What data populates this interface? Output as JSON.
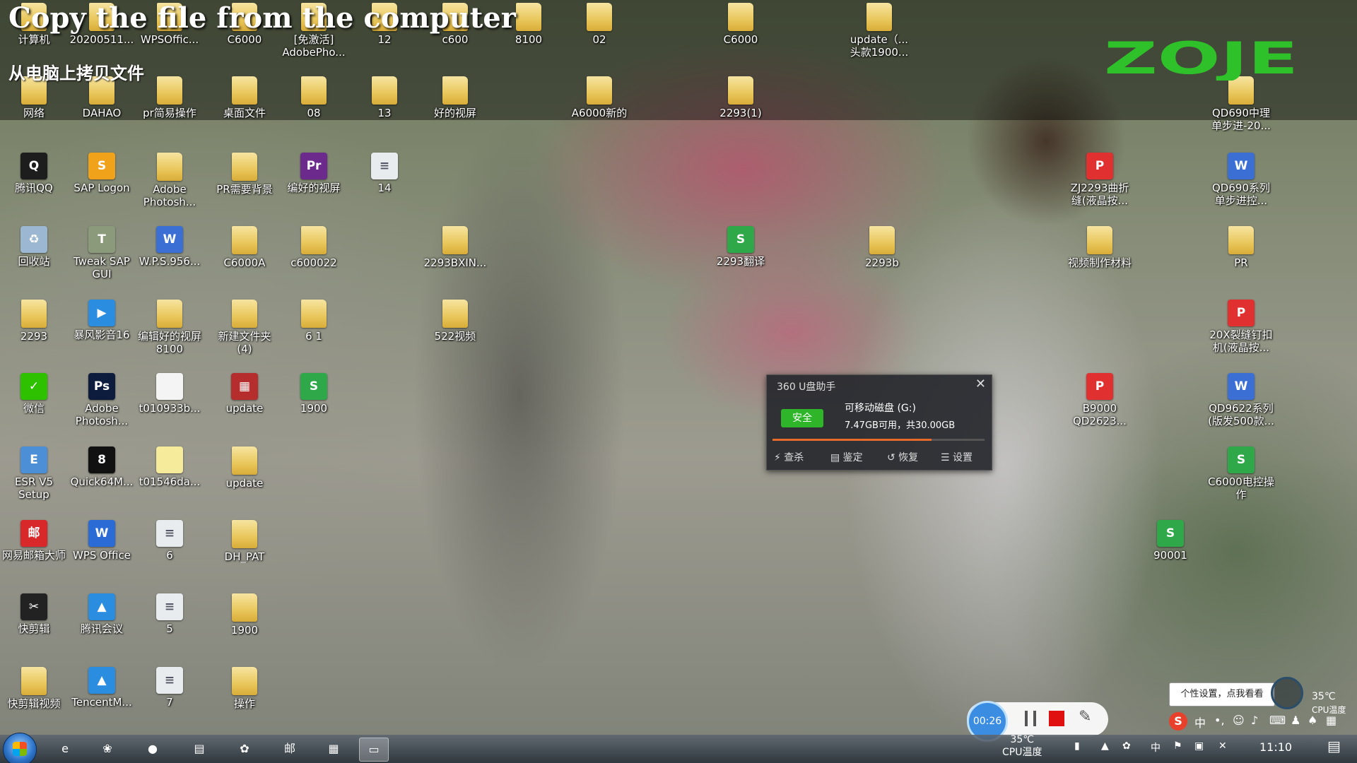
{
  "titles": {
    "english": "Copy the file from the computer",
    "chinese": "从电脑上拷贝文件"
  },
  "logo": "ZOJE",
  "top_icons": [
    {
      "label": "计算机"
    },
    {
      "label": "20200511..."
    },
    {
      "label": "WPSOffic..."
    },
    {
      "label": "C6000"
    },
    {
      "label": "[免激活] AdobePho..."
    },
    {
      "label": "12"
    },
    {
      "label": "c600"
    },
    {
      "label": "8100"
    },
    {
      "label": "02"
    },
    {
      "label": "C6000"
    },
    {
      "label": "update（... 头款1900..."
    },
    {
      "label": "网络"
    },
    {
      "label": "DAHAO"
    },
    {
      "label": "pr简易操作"
    },
    {
      "label": "桌面文件"
    },
    {
      "label": "08"
    },
    {
      "label": "13"
    },
    {
      "label": "好的视屏"
    },
    {
      "label": "A6000新的"
    },
    {
      "label": "2293(1)"
    },
    {
      "label": "QD690中理 单步进-20..."
    }
  ],
  "icons": [
    {
      "label": "腾讯QQ",
      "glyph": "Q",
      "color": "#1d1d1d"
    },
    {
      "label": "SAP Logon",
      "glyph": "S",
      "color": "#f0a31a"
    },
    {
      "label": "Adobe Photosh...",
      "glyph": "",
      "color": "folder"
    },
    {
      "label": "PR需要背景",
      "glyph": "",
      "color": "folder"
    },
    {
      "label": "编好的视屏",
      "glyph": "Pr",
      "color": "#6b2a8c"
    },
    {
      "label": "14",
      "glyph": "≡",
      "color": "#e8ecef"
    },
    {
      "label": "回收站",
      "glyph": "♻",
      "color": "#9bb7d1"
    },
    {
      "label": "Tweak SAP GUI",
      "glyph": "T",
      "color": "#8a9a7a"
    },
    {
      "label": "W.P.S.956...",
      "glyph": "W",
      "color": "#3b6fd4"
    },
    {
      "label": "C6000A",
      "glyph": "",
      "color": "folder"
    },
    {
      "label": "c600022",
      "glyph": "",
      "color": "folder"
    },
    {
      "label": "2293BXIN...",
      "glyph": "",
      "color": "folder"
    },
    {
      "label": "2293翻译",
      "glyph": "S",
      "color": "#2fa84a"
    },
    {
      "label": "2293b",
      "glyph": "",
      "color": "folder"
    },
    {
      "label": "视频制作材料",
      "glyph": "",
      "color": "folder"
    },
    {
      "label": "PR",
      "glyph": "",
      "color": "folder"
    },
    {
      "label": "2293",
      "glyph": "",
      "color": "folder"
    },
    {
      "label": "暴风影音16",
      "glyph": "▶",
      "color": "#2b8de0"
    },
    {
      "label": "编辑好的视屏8100",
      "glyph": "",
      "color": "folder"
    },
    {
      "label": "新建文件夹 (4)",
      "glyph": "",
      "color": "folder"
    },
    {
      "label": "6 1",
      "glyph": "",
      "color": "folder"
    },
    {
      "label": "522视频",
      "glyph": "",
      "color": "folder"
    },
    {
      "label": "20X裂缝钉扣机(液晶按...",
      "glyph": "P",
      "color": "#e03030"
    },
    {
      "label": "微信",
      "glyph": "✓",
      "color": "#2dc100"
    },
    {
      "label": "Adobe Photosh...",
      "glyph": "Ps",
      "color": "#0d1b3d"
    },
    {
      "label": "t010933b...",
      "glyph": "",
      "color": "#f4f4f4"
    },
    {
      "label": "update",
      "glyph": "▦",
      "color": "#b62d2d"
    },
    {
      "label": "1900",
      "glyph": "S",
      "color": "#2fa84a"
    },
    {
      "label": "B9000 QD2623...",
      "glyph": "P",
      "color": "#e03030"
    },
    {
      "label": "QD9622系列(版发500款...",
      "glyph": "W",
      "color": "#3b6fd4"
    },
    {
      "label": "ESR V5 Setup",
      "glyph": "E",
      "color": "#4d8fd6"
    },
    {
      "label": "Quick64M...",
      "glyph": "8",
      "color": "#111111"
    },
    {
      "label": "t01546da...",
      "glyph": "",
      "color": "#f5eb9a"
    },
    {
      "label": "update",
      "glyph": "",
      "color": "folder"
    },
    {
      "label": "C6000电控操作",
      "glyph": "S",
      "color": "#2fa84a"
    },
    {
      "label": "网易邮箱大师",
      "glyph": "邮",
      "color": "#d8282a"
    },
    {
      "label": "WPS Office",
      "glyph": "W",
      "color": "#2b6bd6"
    },
    {
      "label": "6",
      "glyph": "≡",
      "color": "#e8ecef"
    },
    {
      "label": "DH_PAT",
      "glyph": "",
      "color": "folder"
    },
    {
      "label": "90001",
      "glyph": "S",
      "color": "#2fa84a"
    },
    {
      "label": "快剪辑",
      "glyph": "✂",
      "color": "#222222"
    },
    {
      "label": "腾讯会议",
      "glyph": "▲",
      "color": "#2b8de0"
    },
    {
      "label": "5",
      "glyph": "≡",
      "color": "#e8ecef"
    },
    {
      "label": "1900",
      "glyph": "",
      "color": "folder"
    },
    {
      "label": "快剪辑视频",
      "glyph": "",
      "color": "folder"
    },
    {
      "label": "TencentM...",
      "glyph": "▲",
      "color": "#2b8de0"
    },
    {
      "label": "7",
      "glyph": "≡",
      "color": "#e8ecef"
    },
    {
      "label": "操作",
      "glyph": "",
      "color": "folder"
    },
    {
      "label": "ZJ2293曲折缝(液晶按...",
      "glyph": "P",
      "color": "#e03030"
    },
    {
      "label": "QD690系列单步进控...",
      "glyph": "W",
      "color": "#3b6fd4"
    }
  ],
  "usb_popup": {
    "title": "360 U盘助手",
    "close": "✕",
    "status": "安全",
    "drive_name": "可移动磁盘 (G:)",
    "space": "7.47GB可用，共30.00GB",
    "used_fraction": 0.751,
    "actions": [
      {
        "label": "⚡ 查杀"
      },
      {
        "label": "▤ 鉴定"
      },
      {
        "label": "↺ 恢复"
      },
      {
        "label": "☰ 设置"
      }
    ]
  },
  "recorder": {
    "timer": "00:26"
  },
  "tray": {
    "tooltip": "个性设置，点我看看",
    "cpu_temp": "35℃",
    "cpu_label": "CPU温度",
    "clock": "11:10",
    "ime_lang": "中"
  },
  "taskbar": {
    "buttons": [
      {
        "name": "ie",
        "glyph": "e"
      },
      {
        "name": "app-1",
        "glyph": "❀"
      },
      {
        "name": "app-2",
        "glyph": "●"
      },
      {
        "name": "app-3",
        "glyph": "▤"
      },
      {
        "name": "app-4",
        "glyph": "✿"
      },
      {
        "name": "mail",
        "glyph": "邮"
      },
      {
        "name": "app-5",
        "glyph": "▦"
      },
      {
        "name": "explorer",
        "glyph": "▭"
      }
    ]
  }
}
